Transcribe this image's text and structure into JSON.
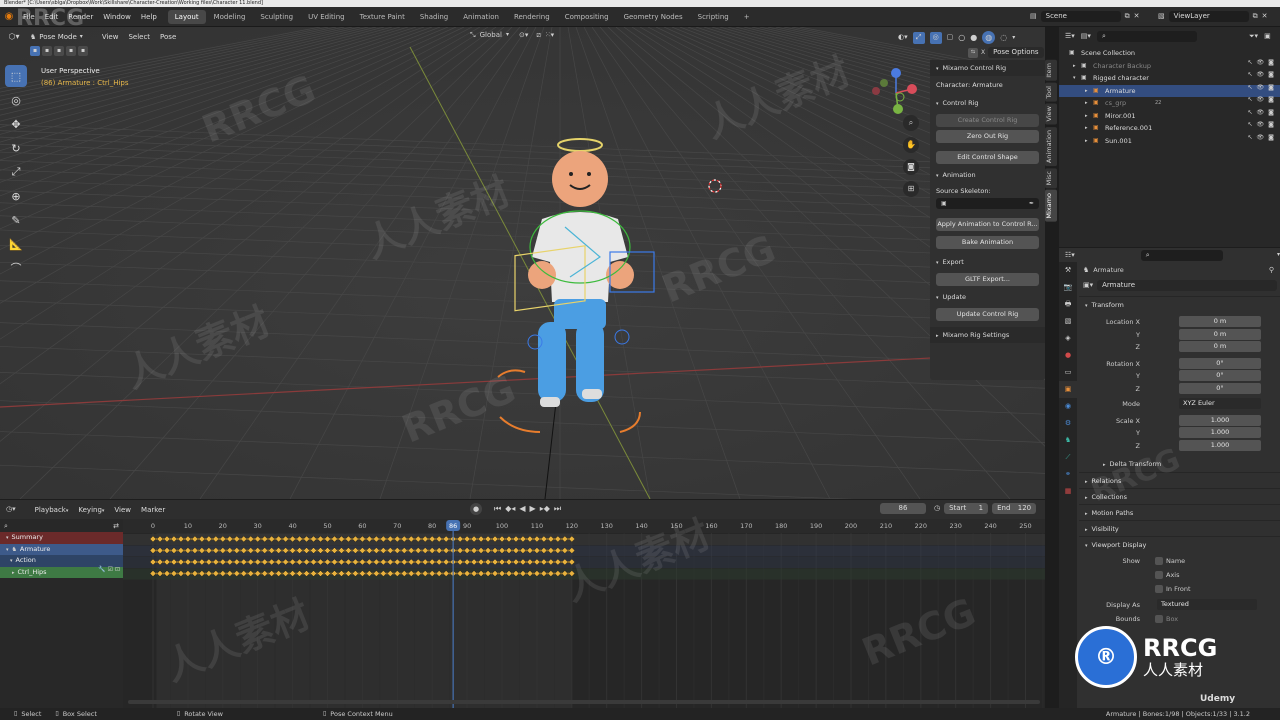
{
  "window": {
    "title": "Blender* [C:\\Users\\sblga\\Dropbox\\Work\\Skillshare\\Character-Creation\\Working files\\Character 11.blend]"
  },
  "menus": [
    "File",
    "Edit",
    "Render",
    "Window",
    "Help"
  ],
  "workspaces": [
    "Layout",
    "Modeling",
    "Sculpting",
    "UV Editing",
    "Texture Paint",
    "Shading",
    "Animation",
    "Rendering",
    "Compositing",
    "Geometry Nodes",
    "Scripting"
  ],
  "active_workspace": "Layout",
  "scene": {
    "name": "Scene",
    "view_layer": "ViewLayer"
  },
  "viewport": {
    "mode": "Pose Mode",
    "menus": [
      "View",
      "Select",
      "Pose"
    ],
    "transform_orientation": "Global",
    "perspective_label": "User Perspective",
    "active_info": "(86) Armature : Ctrl_Hips",
    "pose_options": "Pose Options"
  },
  "npanel": {
    "title": "Mixamo Control Rig",
    "character": "Character: Armature",
    "control_rig": {
      "header": "Control Rig",
      "buttons": [
        "Create Control Rig",
        "Zero Out Rig",
        "Edit Control Shape"
      ]
    },
    "animation": {
      "header": "Animation",
      "source_skeleton_label": "Source Skeleton:",
      "buttons": [
        "Apply Animation to Control R...",
        "Bake Animation"
      ]
    },
    "export": {
      "header": "Export",
      "button": "GLTF Export..."
    },
    "update": {
      "header": "Update",
      "button": "Update Control Rig"
    },
    "settings": {
      "header": "Mixamo Rig Settings"
    }
  },
  "sidebar_tabs": [
    "Item",
    "Tool",
    "View",
    "Animation",
    "Misc",
    "Mixamo"
  ],
  "active_sidebar_tab": "Mixamo",
  "outliner": {
    "rows": [
      {
        "label": "Scene Collection",
        "indent": 0
      },
      {
        "label": "Character Backup",
        "indent": 1,
        "dim": true
      },
      {
        "label": "Rigged character",
        "indent": 1
      },
      {
        "label": "Armature",
        "indent": 2,
        "selected": true
      },
      {
        "label": "cs_grp",
        "indent": 2,
        "dim": true,
        "badge": "22"
      },
      {
        "label": "Miror.001",
        "indent": 2
      },
      {
        "label": "Reference.001",
        "indent": 2
      },
      {
        "label": "Sun.001",
        "indent": 2
      }
    ]
  },
  "properties": {
    "object_name": "Armature",
    "datablock": "Armature",
    "transform_header": "Transform",
    "location": {
      "label": "Location X",
      "y": "Y",
      "z": "Z",
      "values": [
        "0 m",
        "0 m",
        "0 m"
      ]
    },
    "rotation": {
      "label": "Rotation X",
      "y": "Y",
      "z": "Z",
      "values": [
        "0°",
        "0°",
        "0°"
      ]
    },
    "mode": {
      "label": "Mode",
      "value": "XYZ Euler"
    },
    "scale": {
      "label": "Scale X",
      "y": "Y",
      "z": "Z",
      "values": [
        "1.000",
        "1.000",
        "1.000"
      ]
    },
    "sections": [
      "Delta Transform",
      "Relations",
      "Collections",
      "Motion Paths",
      "Visibility",
      "Viewport Display"
    ],
    "viewport_display": {
      "show_label": "Show",
      "checkboxes": [
        "Name",
        "Axis",
        "In Front"
      ],
      "display_as_label": "Display As",
      "display_as_value": "Textured",
      "bounds_label": "Bounds",
      "bounds_value": "Box"
    }
  },
  "timeline": {
    "menus": [
      "Playback",
      "Keying",
      "View",
      "Marker"
    ],
    "current_frame": "86",
    "current_frame_value": 86,
    "start_label": "Start",
    "start": "1",
    "end_label": "End",
    "end": "120",
    "frame_ticks": [
      "0",
      "10",
      "20",
      "30",
      "40",
      "50",
      "60",
      "70",
      "80",
      "90",
      "100",
      "110",
      "120",
      "130",
      "140",
      "150",
      "160",
      "170",
      "180",
      "190",
      "200",
      "210",
      "220",
      "230",
      "240",
      "250"
    ],
    "channels": [
      {
        "label": "Summary",
        "type": "summary"
      },
      {
        "label": "Armature",
        "type": "object"
      },
      {
        "label": "Action",
        "type": "action"
      },
      {
        "label": "Ctrl_Hips",
        "type": "group"
      }
    ]
  },
  "statusbar": {
    "items": [
      "Select",
      "Box Select",
      "Rotate View",
      "Pose Context Menu"
    ],
    "right": "Armature | Bones:1/98 | Objects:1/33 | 3.1.2"
  },
  "watermarks": [
    "RRCG",
    "人人素材"
  ],
  "branding": {
    "udemy": "Udemy",
    "rrcg": "RRCG",
    "rrcg_sub": "人人素材"
  },
  "colors": {
    "accent": "#4772b3",
    "keyframe": "#e8b23e",
    "playhead": "#4772b3"
  }
}
